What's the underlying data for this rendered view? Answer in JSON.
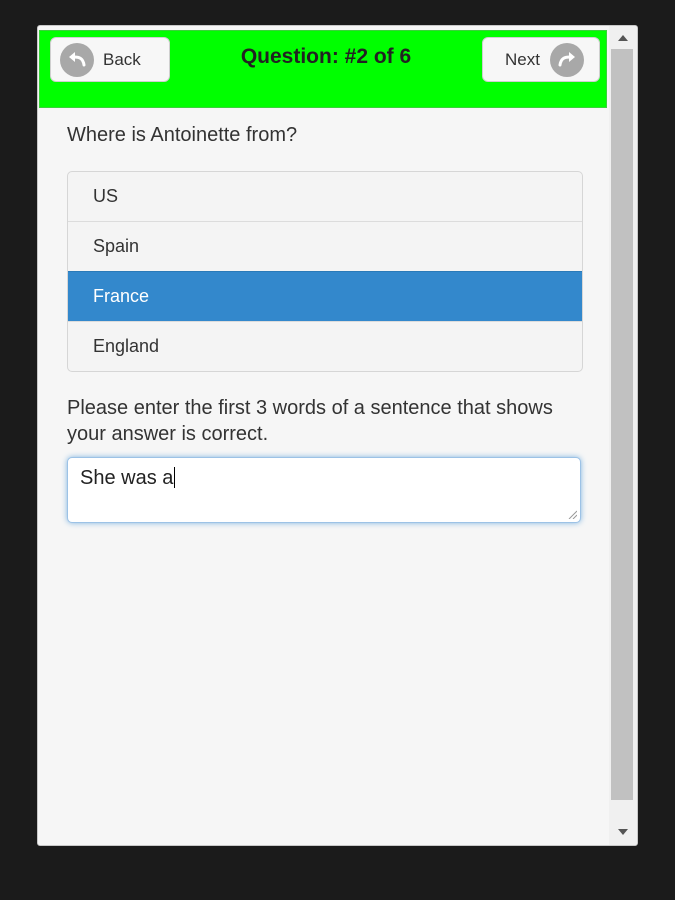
{
  "header": {
    "back_label": "Back",
    "title": "Question: #2 of 6",
    "next_label": "Next",
    "color": "#00ff00"
  },
  "question": {
    "text": "Where is Antoinette from?",
    "options": [
      "US",
      "Spain",
      "France",
      "England"
    ],
    "selected": "France",
    "selected_color": "#3388cc"
  },
  "evidence": {
    "prompt": "Please enter the first 3 words of a sentence that shows your answer is correct.",
    "value": "She was a"
  },
  "icons": {
    "back": "circle-arrow-left-icon",
    "next": "circle-arrow-right-icon",
    "scroll_up": "triangle-up-icon",
    "scroll_down": "triangle-down-icon"
  }
}
